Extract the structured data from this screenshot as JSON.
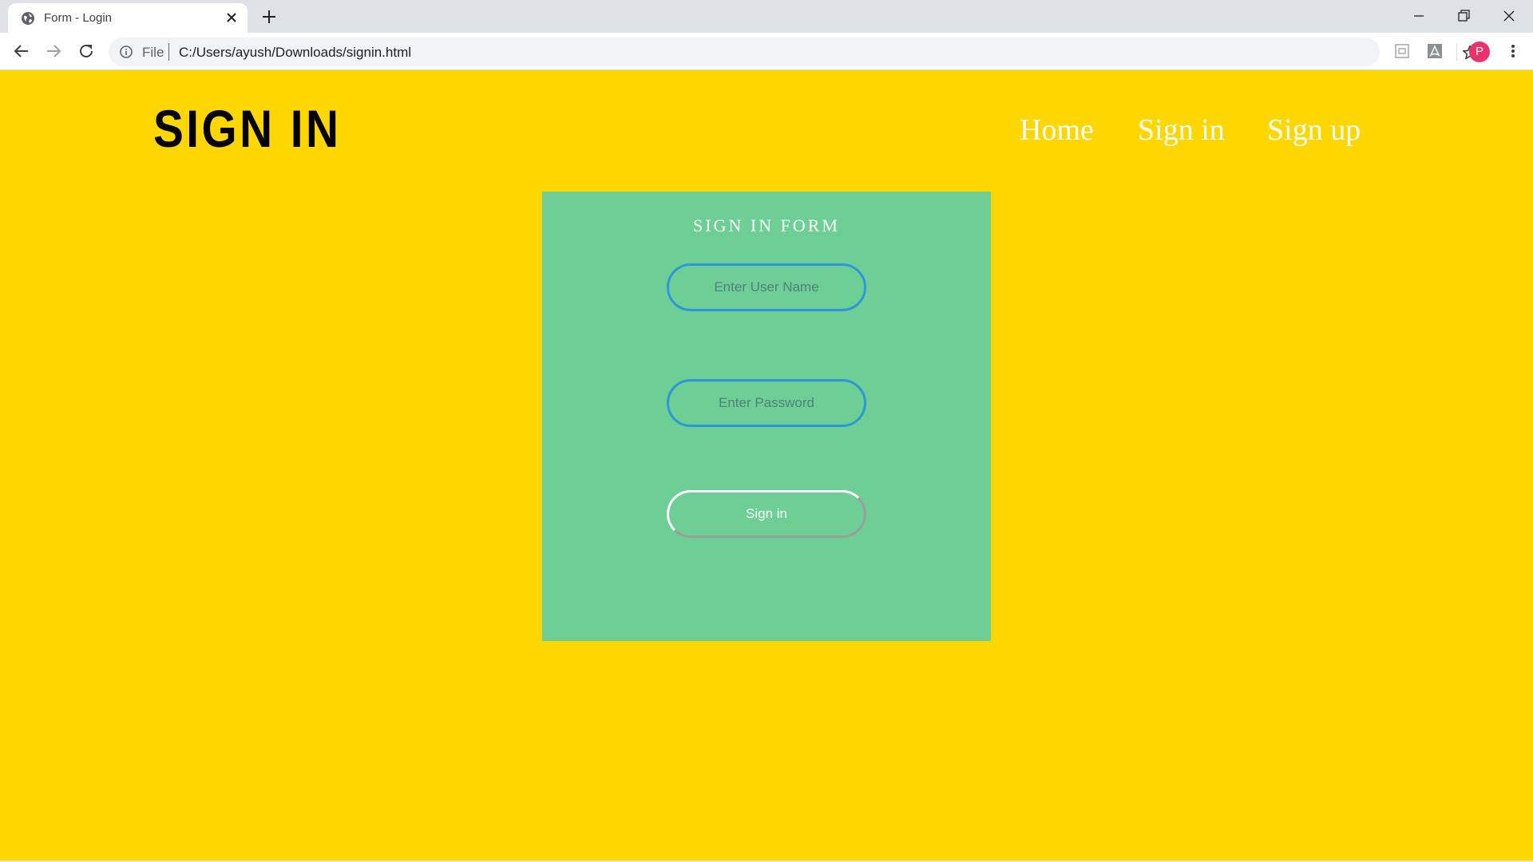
{
  "browser": {
    "tab_title": "Form - Login",
    "address_scheme": "File",
    "address_url": "C:/Users/ayush/Downloads/signin.html",
    "profile_initial": "P",
    "profile_color": "#e8336d"
  },
  "header": {
    "brand": "SIGN IN",
    "nav": [
      "Home",
      "Sign in",
      "Sign up"
    ]
  },
  "form": {
    "title": "SIGN IN FORM",
    "username_placeholder": "Enter User Name",
    "password_placeholder": "Enter Password",
    "submit_label": "Sign in"
  },
  "colors": {
    "page_background": "#ffd700",
    "card_background": "#6dce96",
    "input_border": "#2e97d8"
  }
}
